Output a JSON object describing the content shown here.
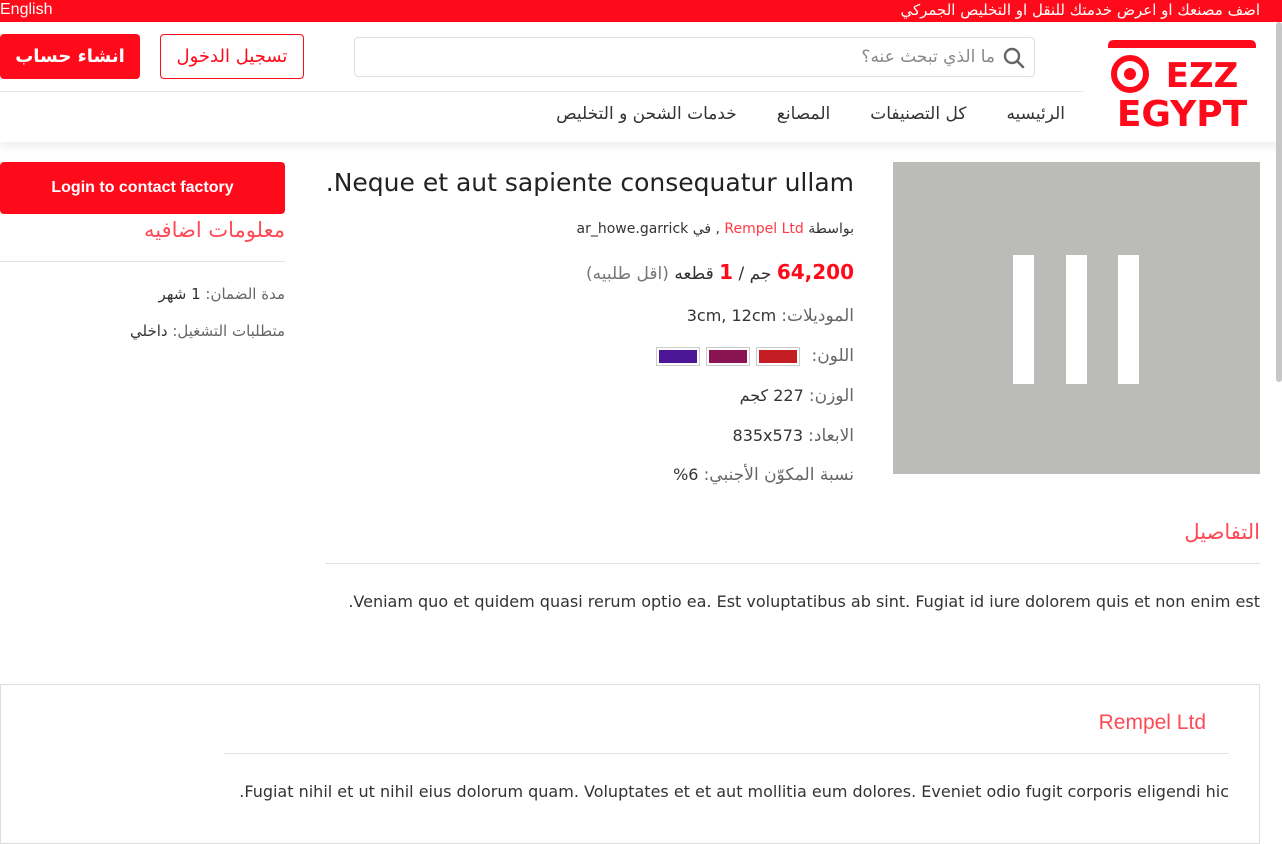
{
  "topbar": {
    "language": "English",
    "promo": "اضف مصنعك او اعرض خدمتك للنقل او التخليص الجمركي"
  },
  "header": {
    "logo_text_top": "EZZ",
    "logo_text_bottom": "EGYPT",
    "search_placeholder": "ما الذي تبحث عنه؟",
    "login_label": "تسجيل الدخول",
    "register_label": "انشاء حساب",
    "nav": [
      "الرئيسيه",
      "كل التصنيفات",
      "المصانع",
      "خدمات الشحن و التخليص"
    ]
  },
  "sidebar": {
    "contact_button": "Login to contact factory",
    "title": "معلومات اضافيه",
    "rows": [
      {
        "label": "مدة الضمان:",
        "value": "1 شهر"
      },
      {
        "label": "متطلبات التشغيل:",
        "value": "داخلي"
      }
    ]
  },
  "product": {
    "title": "Neque et aut sapiente consequatur ullam.",
    "by_prefix": "بواسطة",
    "company": "Rempel Ltd",
    "in_label": ", في",
    "user": "ar_howe.garrick",
    "price": "64,200",
    "currency": "جم /",
    "min_qty": "1",
    "unit": "قطعه",
    "min_label": "(اقل طلبيه)",
    "models_label": "الموديلات:",
    "models_value": "3cm, 12cm",
    "color_label": "اللون:",
    "colors": [
      "#c51d24",
      "#8a1351",
      "#4d1696"
    ],
    "weight_label": "الوزن:",
    "weight_value": "227 كجم",
    "dims_label": "الابعاد:",
    "dims_value": "835x573",
    "foreign_label": "نسبة المكوّن الأجنبي:",
    "foreign_value": "6%"
  },
  "details": {
    "title": "التفاصيل",
    "text": "Veniam quo et quidem quasi rerum optio ea. Est voluptatibus ab sint. Fugiat id iure dolorem quis et non enim est."
  },
  "company": {
    "title": "Rempel Ltd",
    "text": "Fugiat nihil et ut nihil eius dolorum quam. Voluptates et et aut mollitia eum dolores. Eveniet odio fugit corporis eligendi hic."
  },
  "theme": {
    "accent": "#ff0a1a",
    "accent_light": "#ff4a55"
  }
}
